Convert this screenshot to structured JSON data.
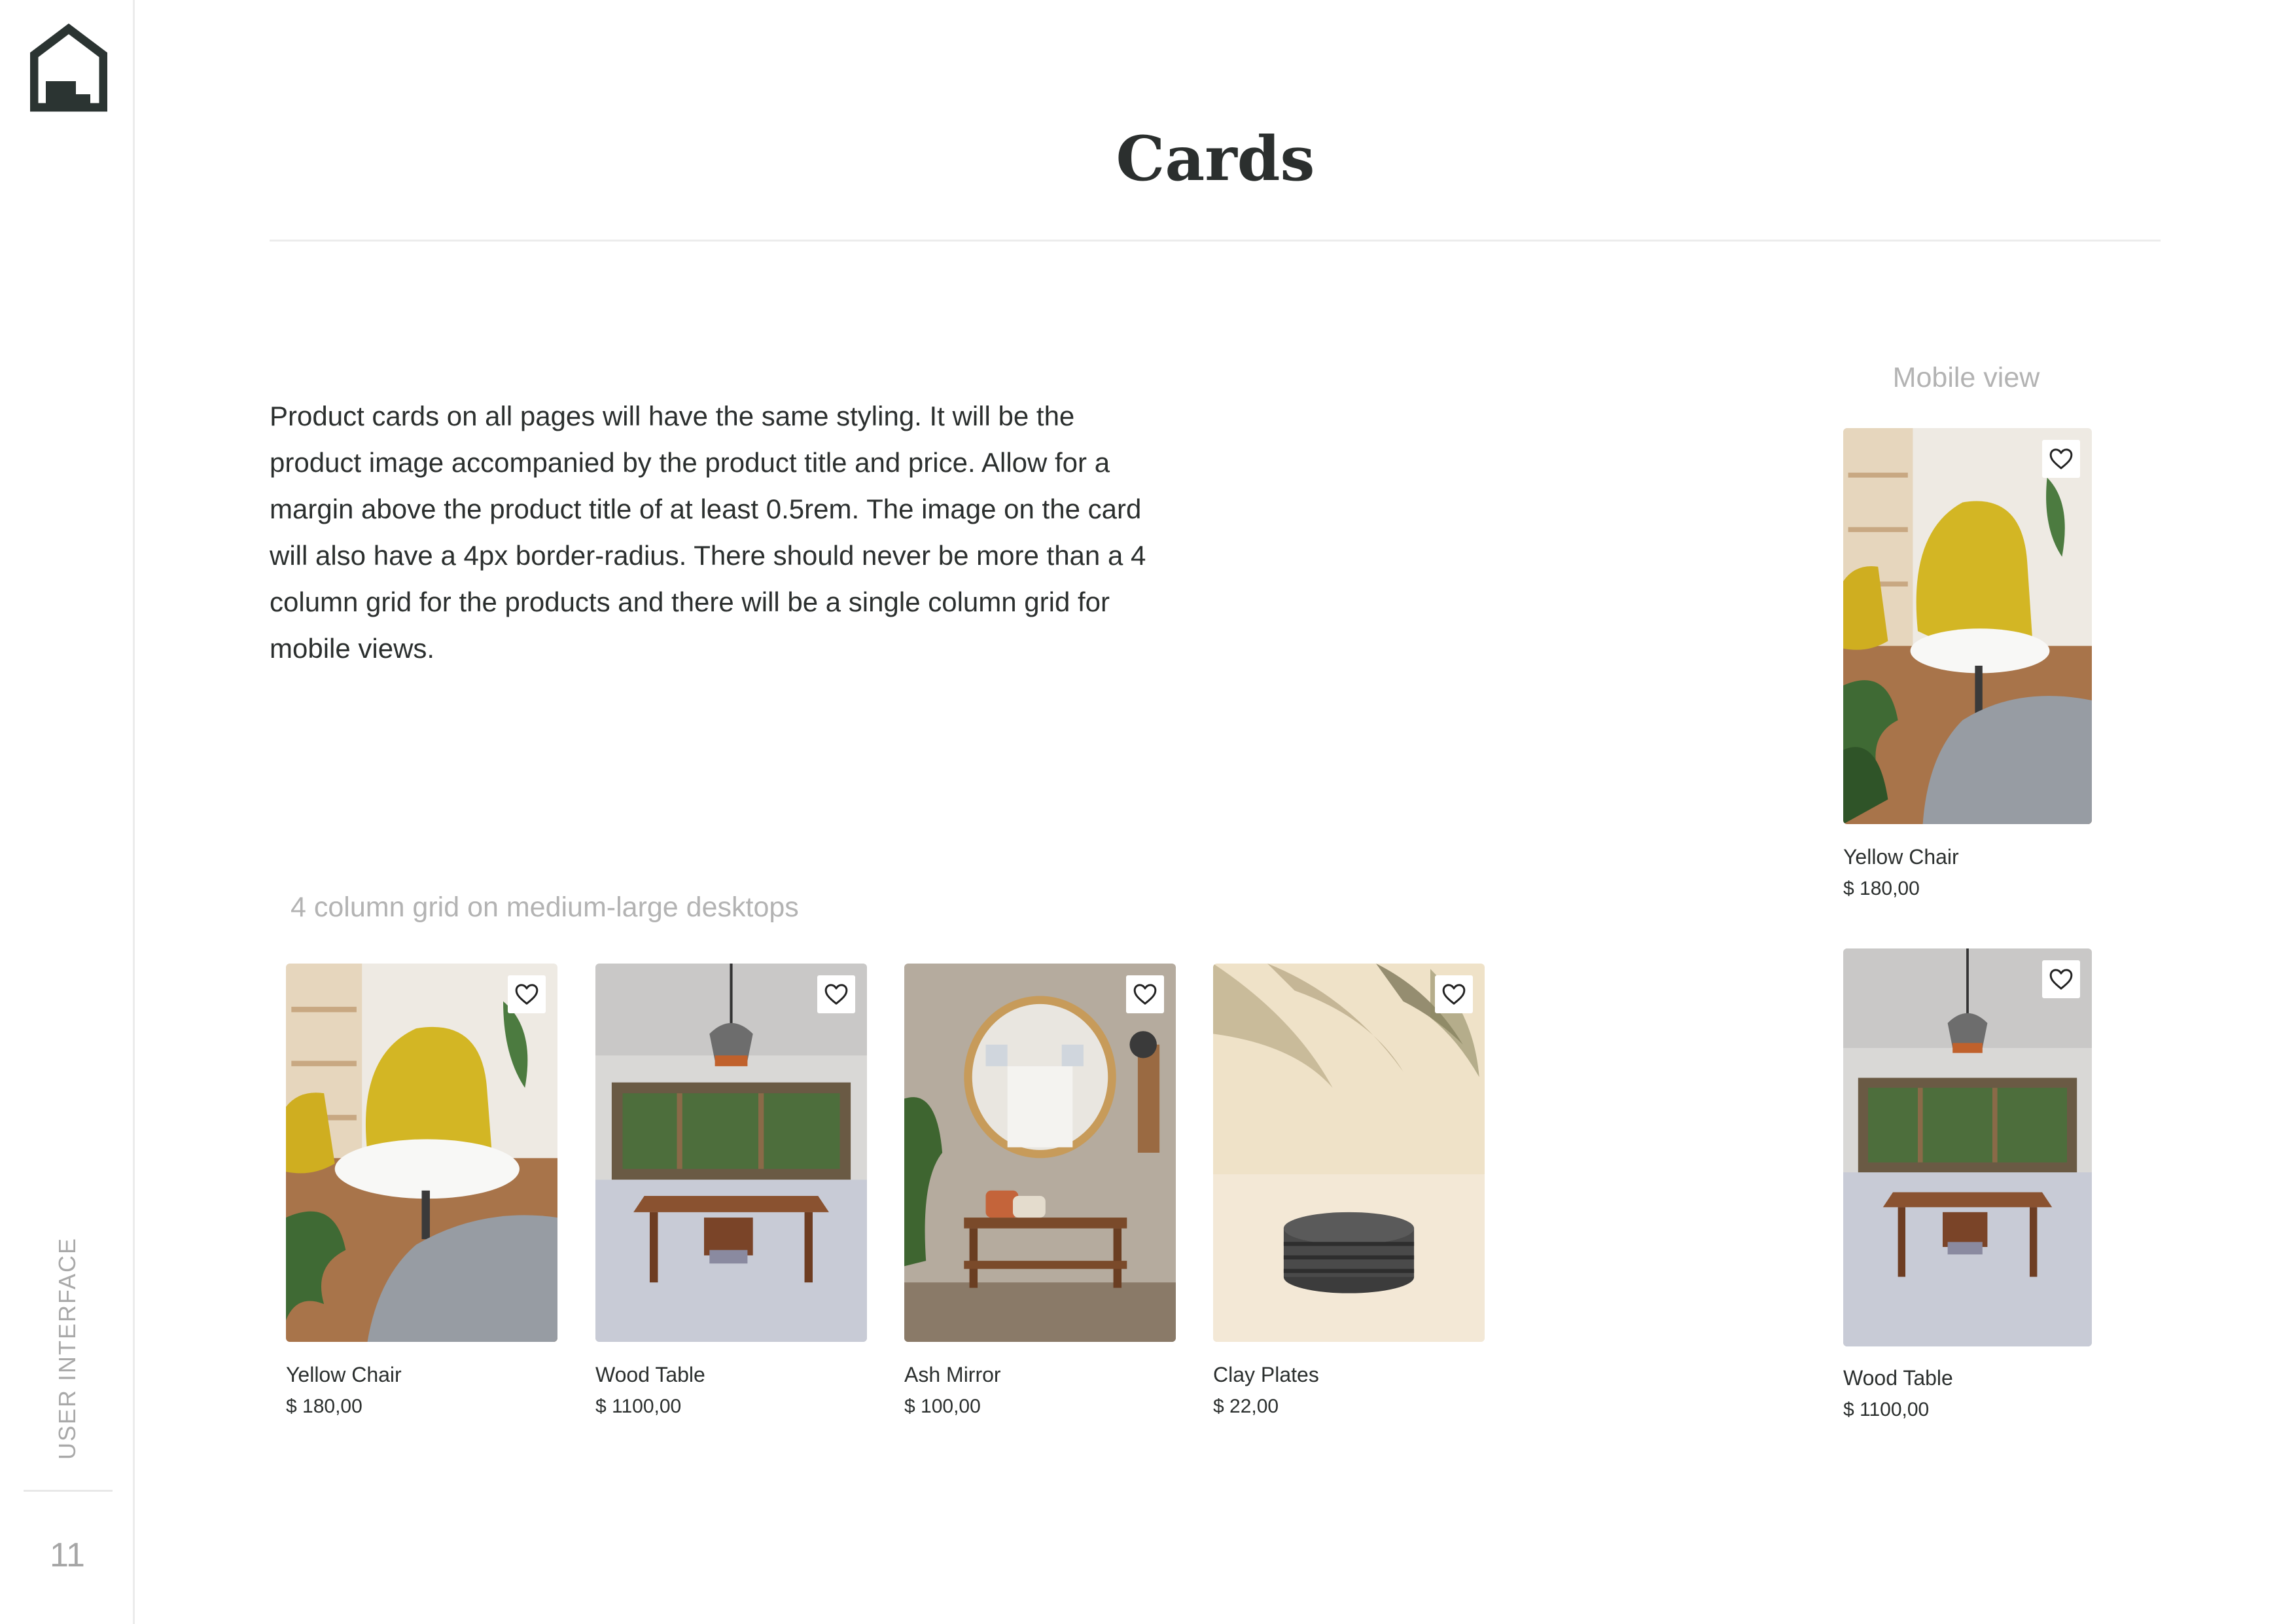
{
  "sidebar": {
    "logo_icon": "house-logo-icon",
    "section_label": "USER INTERFACE",
    "page_number": "11"
  },
  "header": {
    "title": "Cards"
  },
  "intro": {
    "text": "Product cards on all pages will have the same styling. It will be the product image accompanied by the product title and price. Allow for a margin above the product title of at least 0.5rem. The image on the card will also have a 4px border-radius. There should never be more than a 4 column grid for the products and there will be a single column grid for mobile views."
  },
  "mobile": {
    "caption": "Mobile view",
    "cards": [
      {
        "title": "Yellow Chair",
        "price": "$ 180,00",
        "image": "yellow-chair-image"
      },
      {
        "title": "Wood Table",
        "price": "$ 1100,00",
        "image": "wood-table-image"
      }
    ]
  },
  "desktop": {
    "caption": "4 column grid on medium-large desktops",
    "cards": [
      {
        "title": "Yellow Chair",
        "price": "$ 180,00",
        "image": "yellow-chair-image"
      },
      {
        "title": "Wood Table",
        "price": "$ 1100,00",
        "image": "wood-table-image"
      },
      {
        "title": "Ash Mirror",
        "price": "$ 100,00",
        "image": "ash-mirror-image"
      },
      {
        "title": "Clay Plates",
        "price": "$ 22,00",
        "image": "clay-plates-image"
      }
    ]
  },
  "icons": {
    "favorite": "heart-outline-icon"
  },
  "colors": {
    "primary_text": "#2b2f2e",
    "muted_text": "#b3b3b3",
    "divider": "#ececec"
  }
}
